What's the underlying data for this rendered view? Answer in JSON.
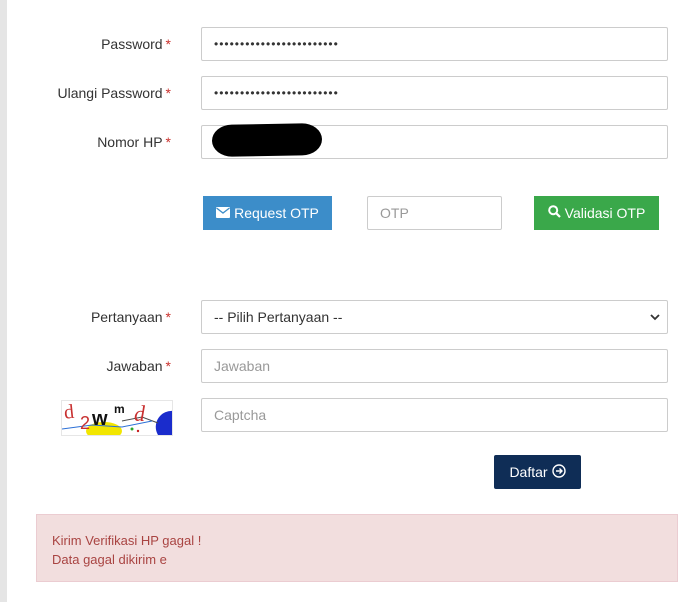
{
  "form": {
    "password": {
      "label": "Password",
      "required_mark": "*",
      "value": "••••••••••••••••••••••••"
    },
    "confirm_password": {
      "label": "Ulangi Password",
      "required_mark": "*",
      "value": "••••••••••••••••••••••••"
    },
    "phone": {
      "label": "Nomor HP",
      "required_mark": "*"
    },
    "otp": {
      "request_label": "Request OTP",
      "placeholder": "OTP",
      "validate_label": "Validasi OTP"
    },
    "question": {
      "label": "Pertanyaan",
      "required_mark": "*",
      "selected": "-- Pilih Pertanyaan --"
    },
    "answer": {
      "label": "Jawaban",
      "required_mark": "*",
      "placeholder": "Jawaban"
    },
    "captcha": {
      "placeholder": "Captcha",
      "image_text": "d2wmd"
    },
    "submit_label": "Daftar"
  },
  "alert": {
    "line1": "Kirim Verifikasi HP gagal !",
    "line2": "Data gagal dikirim e"
  },
  "colors": {
    "request_button": "#3c8dc9",
    "validate_button": "#3aa84a",
    "submit_button": "#0f2d56",
    "required": "#c9302c",
    "alert_bg": "#f2dede",
    "alert_text": "#a94442"
  },
  "icons": {
    "request": "envelope-icon",
    "validate": "search-icon",
    "submit": "arrow-circle-right-icon",
    "select": "chevron-down-icon"
  }
}
